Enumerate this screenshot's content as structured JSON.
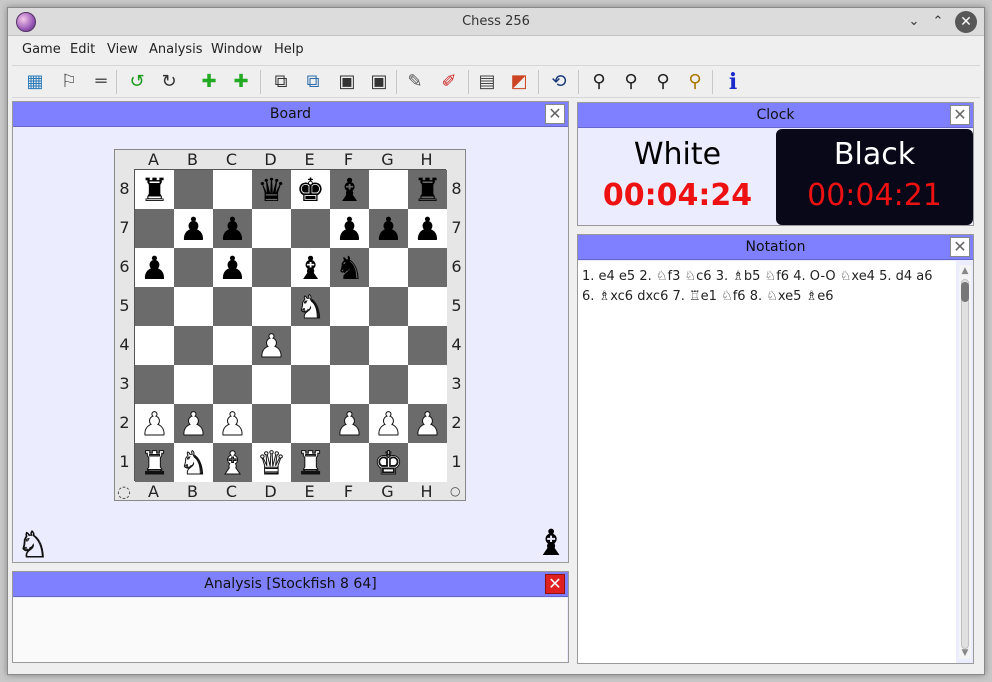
{
  "window": {
    "title": "Chess 256"
  },
  "menu": [
    "Game",
    "Edit",
    "View",
    "Analysis",
    "Window",
    "Help"
  ],
  "toolbar": [
    {
      "icon": "new-game-icon",
      "glyph": "▦",
      "color": "#2a7ab8"
    },
    {
      "icon": "flag-icon",
      "glyph": "⚐",
      "color": "#444444"
    },
    {
      "icon": "draw-icon",
      "glyph": "═",
      "color": "#555555"
    },
    {
      "icon": "undo-icon",
      "glyph": "↺",
      "color": "#1a9a1a"
    },
    {
      "icon": "redo-icon",
      "glyph": "↻",
      "color": "#333333"
    },
    {
      "icon": "add-engine-icon",
      "glyph": "✚",
      "color": "#22aa22"
    },
    {
      "icon": "add-engine-2-icon",
      "glyph": "✚",
      "color": "#22aa22"
    },
    {
      "icon": "copy-icon",
      "glyph": "⧉",
      "color": "#333333"
    },
    {
      "icon": "copy-board-icon",
      "glyph": "⧉",
      "color": "#2a6aa8"
    },
    {
      "icon": "paste-icon",
      "glyph": "▣",
      "color": "#333333"
    },
    {
      "icon": "paste-board-icon",
      "glyph": "▣",
      "color": "#333333"
    },
    {
      "icon": "edit-pen-icon",
      "glyph": "✎",
      "color": "#555555"
    },
    {
      "icon": "no-edit-icon",
      "glyph": "✐",
      "color": "#cc2222"
    },
    {
      "icon": "settings-board-icon",
      "glyph": "▤",
      "color": "#444444"
    },
    {
      "icon": "theme-icon",
      "glyph": "◩",
      "color": "#cc4422"
    },
    {
      "icon": "flip-board-icon",
      "glyph": "⟲",
      "color": "#1a3a7a"
    },
    {
      "icon": "zoom-in-icon",
      "glyph": "⚲",
      "color": "#222222"
    },
    {
      "icon": "zoom-out-icon",
      "glyph": "⚲",
      "color": "#222222"
    },
    {
      "icon": "zoom-fit-icon",
      "glyph": "⚲",
      "color": "#222222"
    },
    {
      "icon": "zoom-reset-icon",
      "glyph": "⚲",
      "color": "#aa7700"
    },
    {
      "icon": "info-icon",
      "glyph": "i",
      "color": "#1a2acc"
    }
  ],
  "board_panel": {
    "title": "Board",
    "files": [
      "A",
      "B",
      "C",
      "D",
      "E",
      "F",
      "G",
      "H"
    ],
    "ranks": [
      "8",
      "7",
      "6",
      "5",
      "4",
      "3",
      "2",
      "1"
    ],
    "position": [
      [
        "r",
        "",
        "",
        "q",
        "k",
        "b",
        "",
        "r"
      ],
      [
        "",
        "p",
        "p",
        "",
        "",
        "p",
        "p",
        "p"
      ],
      [
        "p",
        "",
        "p",
        "",
        "b",
        "n",
        "",
        ""
      ],
      [
        "",
        "",
        "",
        "",
        "N",
        "",
        "",
        ""
      ],
      [
        "",
        "",
        "",
        "P",
        "",
        "",
        "",
        ""
      ],
      [
        "",
        "",
        "",
        "",
        "",
        "",
        "",
        ""
      ],
      [
        "P",
        "P",
        "P",
        "",
        "",
        "P",
        "P",
        "P"
      ],
      [
        "R",
        "N",
        "B",
        "Q",
        "R",
        "",
        "K",
        ""
      ]
    ],
    "captured_white_icon": "♘",
    "captured_black_icon": "♝",
    "rotate_glyph": "◌",
    "turn_glyph": "○"
  },
  "clock": {
    "title": "Clock",
    "white_label": "White",
    "white_time": "00:04:24",
    "black_label": "Black",
    "black_time": "00:04:21",
    "time_color": "#ee1111"
  },
  "notation": {
    "title": "Notation",
    "text": "1. e4 e5 2. ♘f3 ♘c6 3. ♗b5 ♘f6 4. O-O ♘xe4 5. d4 a6 6. ♗xc6 dxc6 7. ♖e1 ♘f6 8. ♘xe5 ♗e6"
  },
  "analysis": {
    "title": "Analysis [Stockfish 8 64]"
  },
  "colors": {
    "dock_header": "#7f80ff",
    "light_square": "#ffffff",
    "dark_square": "#6b6b6b",
    "close_red": "#e02020"
  }
}
